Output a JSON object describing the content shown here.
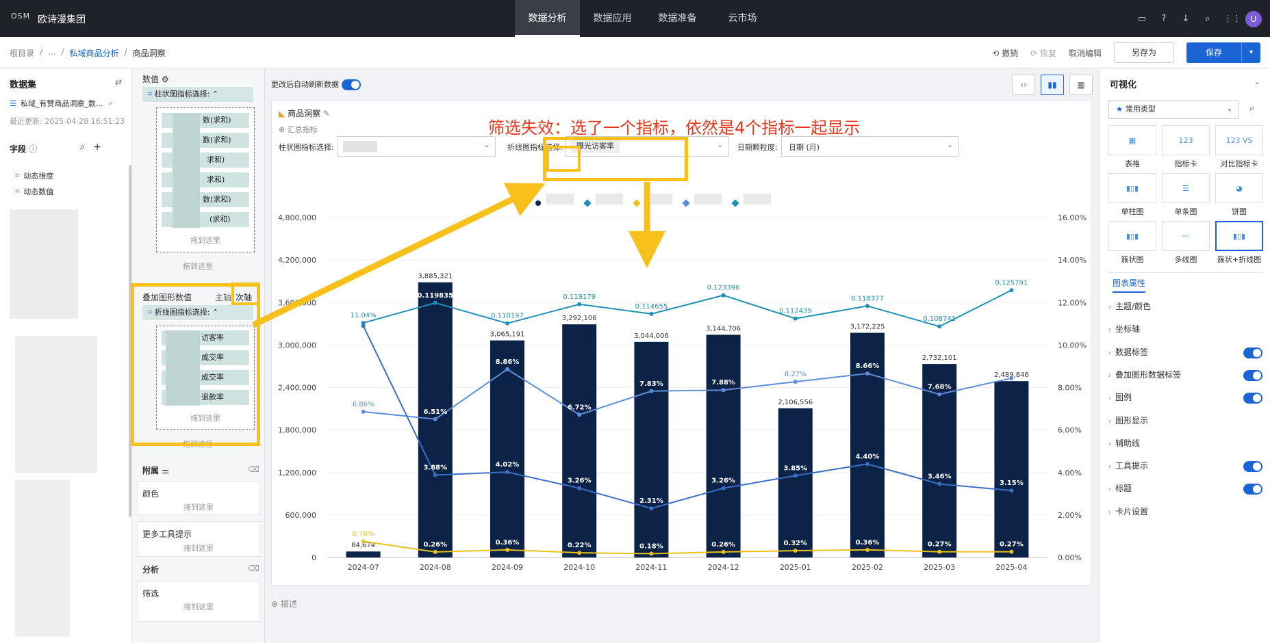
{
  "app": {
    "logo": "OSM",
    "org_name": "欧诗漫集团",
    "nav": [
      "数据分析",
      "数据应用",
      "数据准备",
      "云市场"
    ],
    "nav_active": 0,
    "avatar_letter": "U"
  },
  "breadcrumb": {
    "root": "根目录",
    "ellipsis": "...",
    "parent": "私域商品分析",
    "current": "商品洞察",
    "undo": "撤销",
    "redo": "恢复",
    "cancel_edit": "取消编辑",
    "save_as": "另存为",
    "save": "保存"
  },
  "dataset": {
    "title": "数据集",
    "name": "私域_有赞商品洞察_数...",
    "updated": "最近更新: 2025-04-28 16:51:23",
    "fields_title": "字段",
    "items": [
      "动态维度",
      "动态数值"
    ]
  },
  "config": {
    "data_title": "数值",
    "bar_selector_pill": "柱状图指标选择:",
    "bar_fields": [
      "数(求和)",
      "数(求和)",
      "求和)",
      "求和)",
      "数(求和)",
      "(求和)"
    ],
    "drag_here": "拖到这里",
    "overlay_title": "叠加图形数值",
    "axis_main": "主轴",
    "axis_secondary": "次轴",
    "line_selector_pill": "折线图指标选择:",
    "line_fields": [
      "访客率",
      "成交率",
      "成交率",
      "退款率"
    ],
    "attach_title": "附属",
    "color_label": "颜色",
    "more_tooltip_label": "更多工具提示",
    "analysis_title": "分析",
    "filter_label": "筛选"
  },
  "canvas": {
    "auto_refresh_label": "更改后自动刷新数据",
    "card_title": "商品洞察",
    "summary_link": "汇总指标",
    "bar_selector_label": "柱状图指标选择:",
    "line_selector_label": "折线图指标选择:",
    "line_selector_value": "曝光访客率",
    "date_granularity_label": "日期颗粒度:",
    "date_granularity_value": "日期 (月)",
    "describe_link": "描述"
  },
  "annotation": {
    "text": "筛选失效：选了一个指标，依然是4个指标一起显示",
    "highlight_label_1": "折线图",
    "highlight_label_2": "次轴"
  },
  "properties": {
    "title": "可视化",
    "type_select": "常用类型",
    "chart_types": [
      {
        "label": "表格",
        "icon": "table-icon"
      },
      {
        "label": "指标卡",
        "icon": "kpi-card-icon"
      },
      {
        "label": "对比指标卡",
        "icon": "compare-kpi-icon"
      },
      {
        "label": "单柱图",
        "icon": "column-chart-icon"
      },
      {
        "label": "单条图",
        "icon": "bar-chart-icon"
      },
      {
        "label": "饼图",
        "icon": "pie-chart-icon"
      },
      {
        "label": "簇状图",
        "icon": "clustered-chart-icon"
      },
      {
        "label": "多线图",
        "icon": "multi-line-icon"
      },
      {
        "label": "簇状+折线图",
        "icon": "combo-chart-icon"
      }
    ],
    "kpi_sample": "123",
    "kpi_compare_sample": "VS",
    "tab": "图表属性",
    "rows": [
      {
        "label": "主题/颜色",
        "toggle": null
      },
      {
        "label": "坐标轴",
        "toggle": null
      },
      {
        "label": "数据标签",
        "toggle": true
      },
      {
        "label": "叠加图形数据标签",
        "toggle": true
      },
      {
        "label": "图例",
        "toggle": true
      },
      {
        "label": "图形显示",
        "toggle": null
      },
      {
        "label": "辅助线",
        "toggle": null
      },
      {
        "label": "工具提示",
        "toggle": true
      },
      {
        "label": "标题",
        "toggle": true
      },
      {
        "label": "卡片设置",
        "toggle": null
      }
    ]
  },
  "colors": {
    "accent": "#1a64d6",
    "bar": "#0d2247",
    "annotation_red": "#e8381e",
    "annotation_yellow": "#f8c01a"
  },
  "chart_data": {
    "type": "bar",
    "categories": [
      "2024-07",
      "2024-08",
      "2024-09",
      "2024-10",
      "2024-11",
      "2024-12",
      "2025-01",
      "2025-02",
      "2025-03",
      "2025-04"
    ],
    "bar_values": [
      84674,
      3885321,
      3065191,
      3292106,
      3044006,
      3144706,
      2106556,
      3172225,
      2732101,
      2489846
    ],
    "bar_labels": [
      "84,674",
      "3,885,321",
      "3,065,191",
      "3,292,106",
      "3,044,006",
      "3,144,706",
      "2,106,556",
      "3,172,225",
      "2,732,101",
      "2,489,846"
    ],
    "ylim": [
      0,
      4800000
    ],
    "yticks": [
      "0",
      "600,000",
      "1,200,000",
      "1,800,000",
      "2,400,000",
      "3,000,000",
      "3,600,000",
      "4,200,000",
      "4,800,000"
    ],
    "y2lim": [
      0,
      16
    ],
    "y2ticks": [
      "0.00%",
      "2.00%",
      "4.00%",
      "6.00%",
      "8.00%",
      "10.00%",
      "12.00%",
      "14.00%",
      "16.00%"
    ],
    "lines": [
      {
        "color": "#1f8fb6",
        "values": [
          11.04,
          11.9835,
          11.0197,
          11.9179,
          11.4655,
          12.3396,
          11.2439,
          11.8377,
          10.8741,
          12.5791
        ],
        "labels": [
          "11.04%",
          "0.119835",
          "0.110197",
          "0.119179",
          "0.114655",
          "0.123396",
          "0.112439",
          "0.118377",
          "0.108741",
          "0.125791"
        ]
      },
      {
        "color": "#5b8fdb",
        "values": [
          6.86,
          6.51,
          8.86,
          6.72,
          7.83,
          7.88,
          8.27,
          8.66,
          7.68,
          8.44
        ],
        "labels": [
          "6.86%",
          "6.51%",
          "8.86%",
          "6.72%",
          "7.83%",
          "7.88%",
          "8.27%",
          "8.66%",
          "7.68%",
          ""
        ]
      },
      {
        "color": "#3a6fc7",
        "values": [
          10.9,
          3.88,
          4.02,
          3.26,
          2.31,
          3.26,
          3.85,
          4.4,
          3.46,
          3.15
        ],
        "labels": [
          "",
          "3.88%",
          "4.02%",
          "3.26%",
          "2.31%",
          "3.26%",
          "3.85%",
          "4.40%",
          "3.46%",
          "3.15%"
        ]
      },
      {
        "color": "#e8c21a",
        "values": [
          0.76,
          0.26,
          0.36,
          0.22,
          0.18,
          0.26,
          0.32,
          0.36,
          0.27,
          0.27
        ],
        "labels": [
          "0.76%",
          "0.26%",
          "0.36%",
          "0.22%",
          "0.18%",
          "0.26%",
          "0.32%",
          "0.36%",
          "0.27%",
          "0.27%"
        ]
      }
    ],
    "legend_colors": [
      "#0d2247",
      "#1f8fb6",
      "#e8c21a",
      "#5b8fdb",
      "#1f8fb6"
    ]
  }
}
